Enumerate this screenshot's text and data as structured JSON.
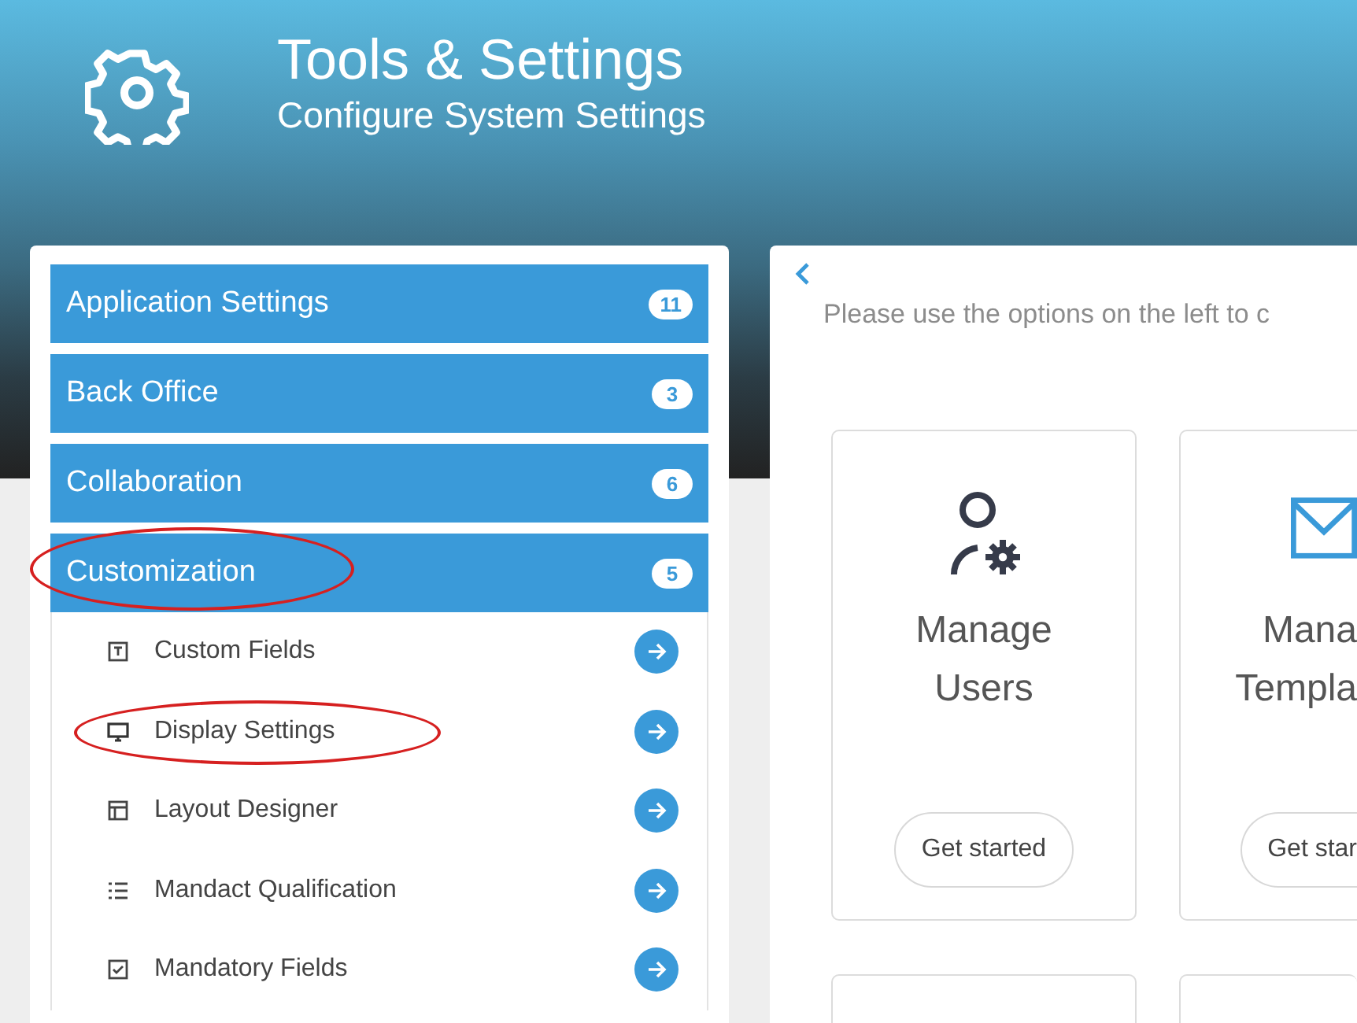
{
  "header": {
    "title": "Tools & Settings",
    "subtitle": "Configure System Settings"
  },
  "sidebar": {
    "categories": [
      {
        "label": "Application Settings",
        "count": "11",
        "expanded": false,
        "circled": false
      },
      {
        "label": "Back Office",
        "count": "3",
        "expanded": false,
        "circled": false
      },
      {
        "label": "Collaboration",
        "count": "6",
        "expanded": false,
        "circled": false
      },
      {
        "label": "Customization",
        "count": "5",
        "expanded": true,
        "circled": true,
        "children": [
          {
            "label": "Custom Fields",
            "circled": false
          },
          {
            "label": "Display Settings",
            "circled": true
          },
          {
            "label": "Layout Designer",
            "circled": false
          },
          {
            "label": "Mandact Qualification",
            "circled": false
          },
          {
            "label": "Mandatory Fields",
            "circled": false
          }
        ]
      }
    ]
  },
  "main": {
    "intro": "Please use the options on the left to c",
    "cards": [
      {
        "title_lines": [
          "Manage",
          "Users"
        ],
        "button": "Get started"
      },
      {
        "title_lines": [
          "Mana",
          "Templa"
        ],
        "button": "Get star"
      }
    ]
  }
}
